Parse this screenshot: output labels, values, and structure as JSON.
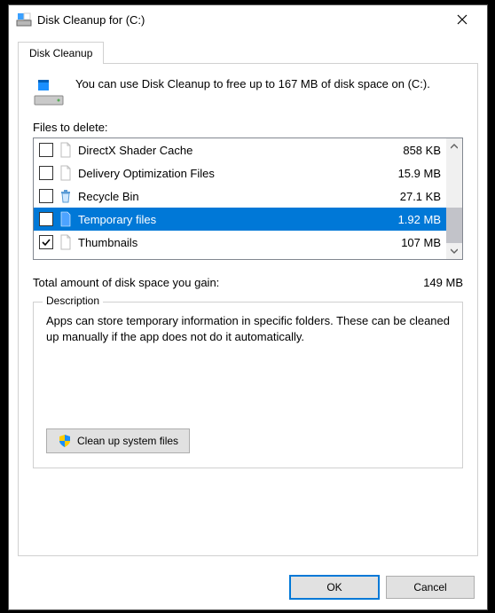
{
  "window": {
    "title": "Disk Cleanup for  (C:)"
  },
  "tab": {
    "label": "Disk Cleanup"
  },
  "intro": {
    "text": "You can use Disk Cleanup to free up to 167 MB of disk space on  (C:)."
  },
  "files_label": "Files to delete:",
  "items": [
    {
      "name": "DirectX Shader Cache",
      "size": "858 KB",
      "checked": false,
      "icon": "page",
      "selected": false
    },
    {
      "name": "Delivery Optimization Files",
      "size": "15.9 MB",
      "checked": false,
      "icon": "page",
      "selected": false
    },
    {
      "name": "Recycle Bin",
      "size": "27.1 KB",
      "checked": false,
      "icon": "recycle",
      "selected": false
    },
    {
      "name": "Temporary files",
      "size": "1.92 MB",
      "checked": false,
      "icon": "page-blue",
      "selected": true
    },
    {
      "name": "Thumbnails",
      "size": "107 MB",
      "checked": true,
      "icon": "page",
      "selected": false
    }
  ],
  "total": {
    "label": "Total amount of disk space you gain:",
    "value": "149 MB"
  },
  "description": {
    "legend": "Description",
    "text": "Apps can store temporary information in specific folders. These can be cleaned up manually if the app does not do it automatically."
  },
  "sysfiles_button": "Clean up system files",
  "buttons": {
    "ok": "OK",
    "cancel": "Cancel"
  }
}
